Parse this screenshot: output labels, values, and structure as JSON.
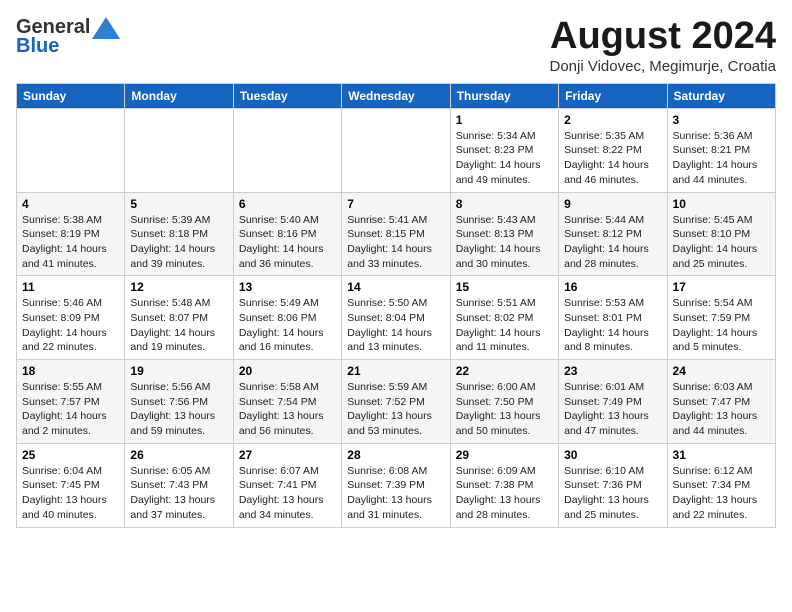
{
  "header": {
    "logo_general": "General",
    "logo_blue": "Blue",
    "month_title": "August 2024",
    "location": "Donji Vidovec, Megimurje, Croatia"
  },
  "days_of_week": [
    "Sunday",
    "Monday",
    "Tuesday",
    "Wednesday",
    "Thursday",
    "Friday",
    "Saturday"
  ],
  "weeks": [
    [
      {
        "day": "",
        "info": ""
      },
      {
        "day": "",
        "info": ""
      },
      {
        "day": "",
        "info": ""
      },
      {
        "day": "",
        "info": ""
      },
      {
        "day": "1",
        "info": "Sunrise: 5:34 AM\nSunset: 8:23 PM\nDaylight: 14 hours\nand 49 minutes."
      },
      {
        "day": "2",
        "info": "Sunrise: 5:35 AM\nSunset: 8:22 PM\nDaylight: 14 hours\nand 46 minutes."
      },
      {
        "day": "3",
        "info": "Sunrise: 5:36 AM\nSunset: 8:21 PM\nDaylight: 14 hours\nand 44 minutes."
      }
    ],
    [
      {
        "day": "4",
        "info": "Sunrise: 5:38 AM\nSunset: 8:19 PM\nDaylight: 14 hours\nand 41 minutes."
      },
      {
        "day": "5",
        "info": "Sunrise: 5:39 AM\nSunset: 8:18 PM\nDaylight: 14 hours\nand 39 minutes."
      },
      {
        "day": "6",
        "info": "Sunrise: 5:40 AM\nSunset: 8:16 PM\nDaylight: 14 hours\nand 36 minutes."
      },
      {
        "day": "7",
        "info": "Sunrise: 5:41 AM\nSunset: 8:15 PM\nDaylight: 14 hours\nand 33 minutes."
      },
      {
        "day": "8",
        "info": "Sunrise: 5:43 AM\nSunset: 8:13 PM\nDaylight: 14 hours\nand 30 minutes."
      },
      {
        "day": "9",
        "info": "Sunrise: 5:44 AM\nSunset: 8:12 PM\nDaylight: 14 hours\nand 28 minutes."
      },
      {
        "day": "10",
        "info": "Sunrise: 5:45 AM\nSunset: 8:10 PM\nDaylight: 14 hours\nand 25 minutes."
      }
    ],
    [
      {
        "day": "11",
        "info": "Sunrise: 5:46 AM\nSunset: 8:09 PM\nDaylight: 14 hours\nand 22 minutes."
      },
      {
        "day": "12",
        "info": "Sunrise: 5:48 AM\nSunset: 8:07 PM\nDaylight: 14 hours\nand 19 minutes."
      },
      {
        "day": "13",
        "info": "Sunrise: 5:49 AM\nSunset: 8:06 PM\nDaylight: 14 hours\nand 16 minutes."
      },
      {
        "day": "14",
        "info": "Sunrise: 5:50 AM\nSunset: 8:04 PM\nDaylight: 14 hours\nand 13 minutes."
      },
      {
        "day": "15",
        "info": "Sunrise: 5:51 AM\nSunset: 8:02 PM\nDaylight: 14 hours\nand 11 minutes."
      },
      {
        "day": "16",
        "info": "Sunrise: 5:53 AM\nSunset: 8:01 PM\nDaylight: 14 hours\nand 8 minutes."
      },
      {
        "day": "17",
        "info": "Sunrise: 5:54 AM\nSunset: 7:59 PM\nDaylight: 14 hours\nand 5 minutes."
      }
    ],
    [
      {
        "day": "18",
        "info": "Sunrise: 5:55 AM\nSunset: 7:57 PM\nDaylight: 14 hours\nand 2 minutes."
      },
      {
        "day": "19",
        "info": "Sunrise: 5:56 AM\nSunset: 7:56 PM\nDaylight: 13 hours\nand 59 minutes."
      },
      {
        "day": "20",
        "info": "Sunrise: 5:58 AM\nSunset: 7:54 PM\nDaylight: 13 hours\nand 56 minutes."
      },
      {
        "day": "21",
        "info": "Sunrise: 5:59 AM\nSunset: 7:52 PM\nDaylight: 13 hours\nand 53 minutes."
      },
      {
        "day": "22",
        "info": "Sunrise: 6:00 AM\nSunset: 7:50 PM\nDaylight: 13 hours\nand 50 minutes."
      },
      {
        "day": "23",
        "info": "Sunrise: 6:01 AM\nSunset: 7:49 PM\nDaylight: 13 hours\nand 47 minutes."
      },
      {
        "day": "24",
        "info": "Sunrise: 6:03 AM\nSunset: 7:47 PM\nDaylight: 13 hours\nand 44 minutes."
      }
    ],
    [
      {
        "day": "25",
        "info": "Sunrise: 6:04 AM\nSunset: 7:45 PM\nDaylight: 13 hours\nand 40 minutes."
      },
      {
        "day": "26",
        "info": "Sunrise: 6:05 AM\nSunset: 7:43 PM\nDaylight: 13 hours\nand 37 minutes."
      },
      {
        "day": "27",
        "info": "Sunrise: 6:07 AM\nSunset: 7:41 PM\nDaylight: 13 hours\nand 34 minutes."
      },
      {
        "day": "28",
        "info": "Sunrise: 6:08 AM\nSunset: 7:39 PM\nDaylight: 13 hours\nand 31 minutes."
      },
      {
        "day": "29",
        "info": "Sunrise: 6:09 AM\nSunset: 7:38 PM\nDaylight: 13 hours\nand 28 minutes."
      },
      {
        "day": "30",
        "info": "Sunrise: 6:10 AM\nSunset: 7:36 PM\nDaylight: 13 hours\nand 25 minutes."
      },
      {
        "day": "31",
        "info": "Sunrise: 6:12 AM\nSunset: 7:34 PM\nDaylight: 13 hours\nand 22 minutes."
      }
    ]
  ]
}
